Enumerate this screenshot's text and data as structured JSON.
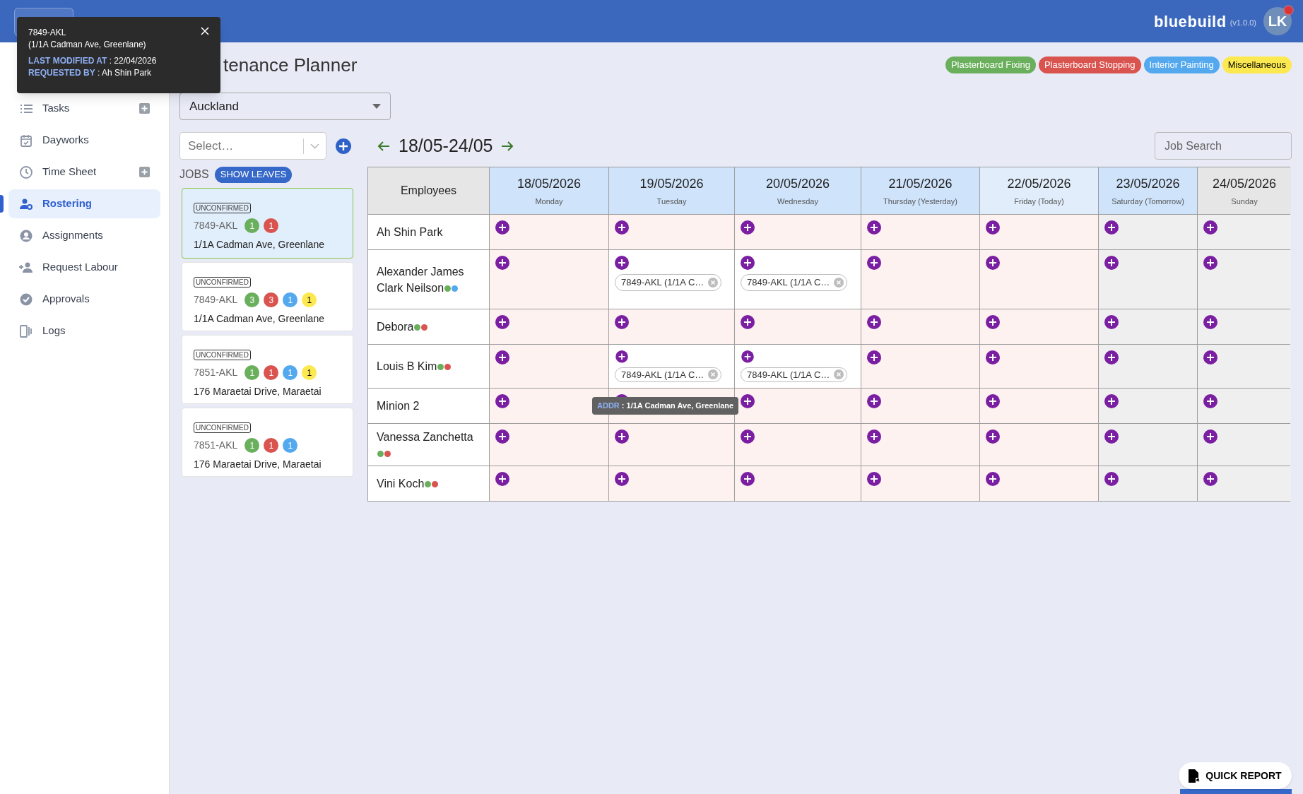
{
  "header": {
    "brand": "bluebuild",
    "version": "(v1.0.0)",
    "avatar": "LK",
    "notification": true
  },
  "tooltip": {
    "title": "7849-AKL",
    "subtitle": "(1/1A Cadman Ave, Greenlane)",
    "fields": [
      {
        "label": "LAST MODIFIED AT",
        "value": " : 22/04/2026"
      },
      {
        "label": "REQUESTED BY",
        "value": " : Ah Shin Park"
      }
    ]
  },
  "sidebar": {
    "items": [
      {
        "label": "Tasks",
        "add": true,
        "selected": false
      },
      {
        "label": "Dayworks",
        "add": false,
        "selected": false
      },
      {
        "label": "Time Sheet",
        "add": true,
        "selected": false
      },
      {
        "label": "Rostering",
        "add": false,
        "selected": true
      },
      {
        "label": "Assignments",
        "add": false,
        "selected": false
      },
      {
        "label": "Request Labour",
        "add": false,
        "selected": false
      },
      {
        "label": "Approvals",
        "add": false,
        "selected": false
      },
      {
        "label": "Logs",
        "add": false,
        "selected": false
      }
    ]
  },
  "page_title": "tenance Planner",
  "tags": [
    {
      "label": "Plasterboard Fixing",
      "color": "#6aaf5c"
    },
    {
      "label": "Plasterboard Stopping",
      "color": "#d9534f"
    },
    {
      "label": "Interior Painting",
      "color": "#54a9ee"
    },
    {
      "label": "Miscellaneous",
      "color": "#fce94f"
    }
  ],
  "branch_area": {
    "value": "Auckland"
  },
  "job_select": {
    "placeholder": "Select…"
  },
  "jobs_label": "JOBS",
  "show_leaves": "SHOW LEAVES",
  "jobs": [
    {
      "status": "UNCONFIRMED",
      "code": "7849-AKL",
      "address": "1/1A Cadman Ave, Greenlane",
      "selected": true,
      "badges": [
        {
          "count": "1",
          "color": "#6aaf5c"
        },
        {
          "count": "1",
          "color": "#d9534f"
        }
      ]
    },
    {
      "status": "UNCONFIRMED",
      "code": "7849-AKL",
      "address": "1/1A Cadman Ave, Greenlane",
      "selected": false,
      "badges": [
        {
          "count": "3",
          "color": "#6aaf5c"
        },
        {
          "count": "3",
          "color": "#d9534f"
        },
        {
          "count": "1",
          "color": "#54a9ee"
        },
        {
          "count": "1",
          "color": "#fce94f"
        }
      ]
    },
    {
      "status": "UNCONFIRMED",
      "code": "7851-AKL",
      "address": "176 Maraetai Drive, Maraetai",
      "selected": false,
      "badges": [
        {
          "count": "1",
          "color": "#6aaf5c"
        },
        {
          "count": "1",
          "color": "#d9534f"
        },
        {
          "count": "1",
          "color": "#54a9ee"
        },
        {
          "count": "1",
          "color": "#fce94f"
        }
      ]
    },
    {
      "status": "UNCONFIRMED",
      "code": "7851-AKL",
      "address": "176 Maraetai Drive, Maraetai",
      "selected": false,
      "badges": [
        {
          "count": "1",
          "color": "#6aaf5c"
        },
        {
          "count": "1",
          "color": "#d9534f"
        },
        {
          "count": "1",
          "color": "#54a9ee"
        }
      ]
    }
  ],
  "week_range": "18/05-24/05",
  "job_search": {
    "placeholder": "Job Search"
  },
  "table": {
    "corner": "Employees",
    "columns": [
      {
        "date": "18/05/2026",
        "day": "Monday",
        "kind": "weekday"
      },
      {
        "date": "19/05/2026",
        "day": "Tuesday",
        "kind": "weekday"
      },
      {
        "date": "20/05/2026",
        "day": "Wednesday",
        "kind": "weekday"
      },
      {
        "date": "21/05/2026",
        "day": "Thursday (Yesterday)",
        "kind": "weekday"
      },
      {
        "date": "22/05/2026",
        "day": "Friday (Today)",
        "kind": "today"
      },
      {
        "date": "23/05/2026",
        "day": "Saturday (Tomorrow)",
        "kind": "saturday"
      },
      {
        "date": "24/05/2026",
        "day": "Sunday",
        "kind": "sunday"
      }
    ],
    "rows": [
      {
        "name": "Ah Shin Park",
        "cells": [
          {},
          {},
          {},
          {},
          {},
          {},
          {}
        ]
      },
      {
        "name": "Alexander James Clark Neilson",
        "dots": [
          {
            "color": "#6aaf5c"
          },
          {
            "color": "#54a9ee"
          }
        ],
        "cells": [
          {},
          {
            "chips": [
              "7849-AKL (1/1A C…"
            ]
          },
          {
            "chips": [
              "7849-AKL (1/1A C…"
            ]
          },
          {},
          {},
          {},
          {}
        ]
      },
      {
        "name": "Debora",
        "dots": [
          {
            "color": "#6aaf5c"
          },
          {
            "color": "#d9534f"
          }
        ],
        "cells": [
          {},
          {},
          {},
          {},
          {},
          {},
          {}
        ]
      },
      {
        "name": "Louis B Kim",
        "dots": [
          {
            "color": "#6aaf5c"
          },
          {
            "color": "#d9534f"
          }
        ],
        "cells": [
          {},
          {
            "chips": [
              "7849-AKL (1/1A C…"
            ]
          },
          {
            "chips": [
              "7849-AKL (1/1A C…"
            ]
          },
          {},
          {},
          {},
          {}
        ]
      },
      {
        "name": "Minion 2",
        "cells": [
          {},
          {},
          {},
          {},
          {},
          {},
          {}
        ]
      },
      {
        "name": "Vanessa Zanchetta",
        "dots": [
          {
            "color": "#6aaf5c"
          },
          {
            "color": "#d9534f"
          }
        ],
        "cells": [
          {},
          {},
          {},
          {},
          {},
          {},
          {}
        ]
      },
      {
        "name": "Vini Koch",
        "dots": [
          {
            "color": "#6aaf5c"
          },
          {
            "color": "#d9534f"
          }
        ],
        "cells": [
          {},
          {},
          {},
          {},
          {},
          {},
          {}
        ]
      }
    ]
  },
  "hover_tooltip": {
    "label": "ADDR",
    "value": " : 1/1A Cadman Ave, Greenlane"
  },
  "quick_report": "QUICK REPORT"
}
